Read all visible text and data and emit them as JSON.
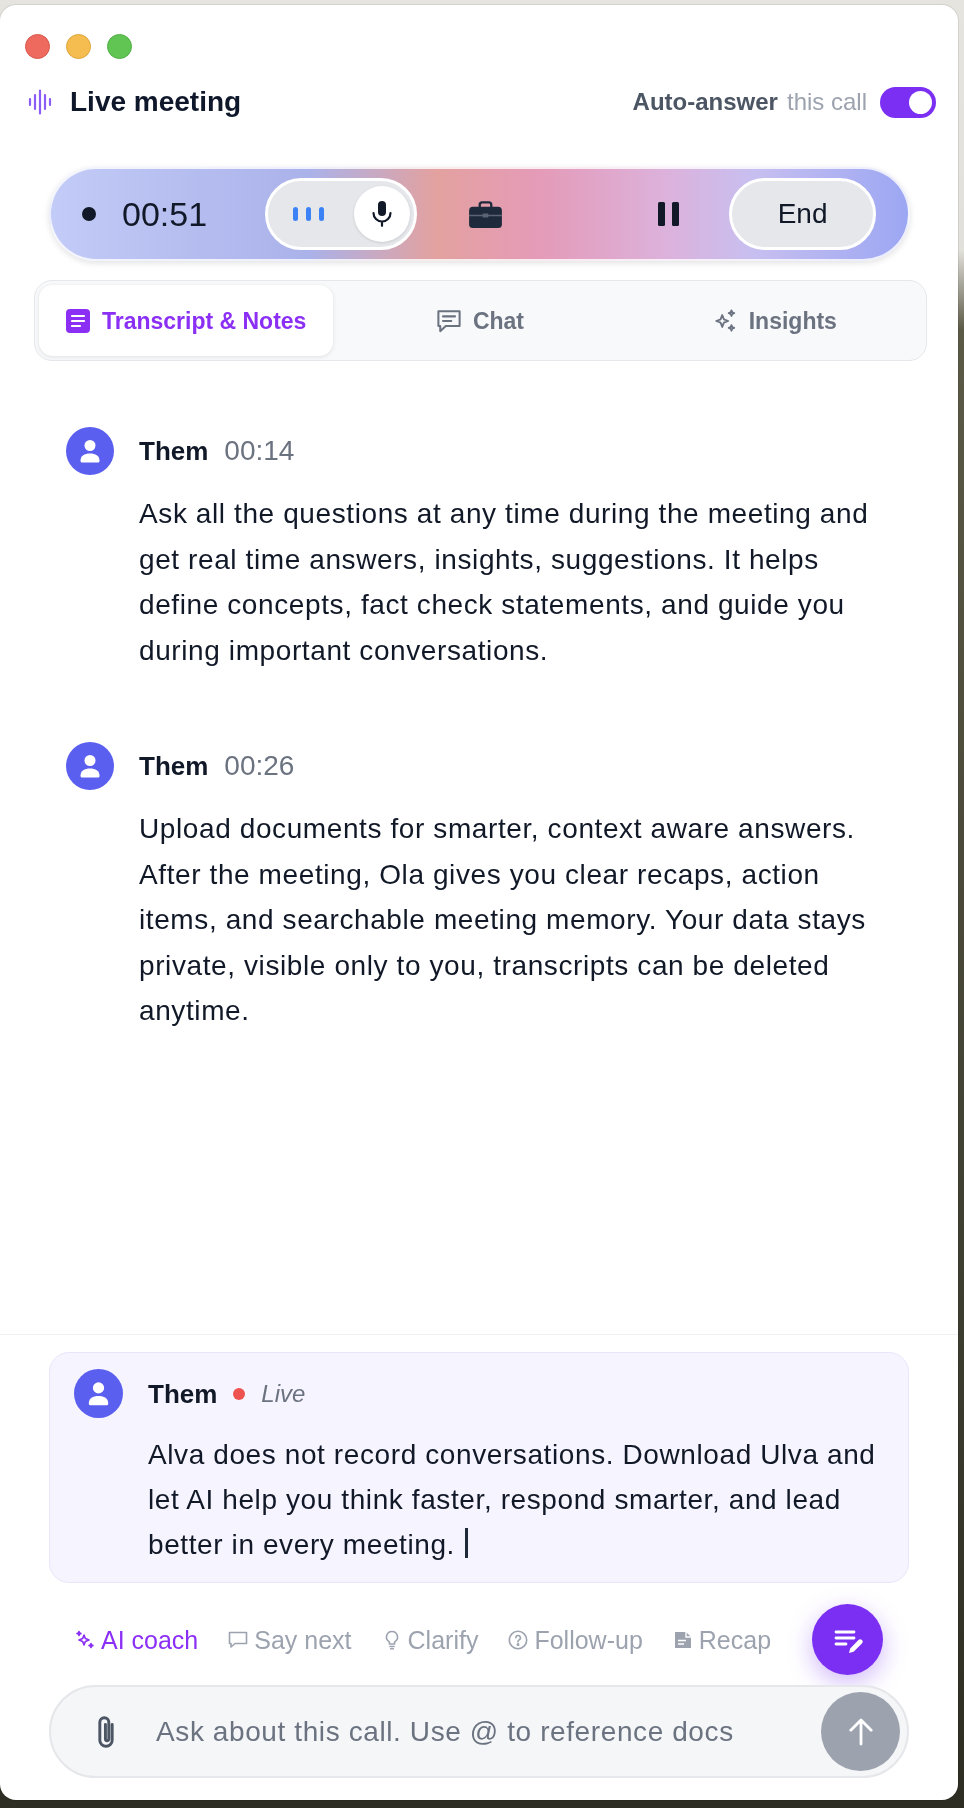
{
  "window": {
    "title": "Live meeting"
  },
  "auto_answer": {
    "label": "Auto-answer",
    "note": "this call",
    "on": true
  },
  "call_bar": {
    "timer": "00:51",
    "mic_selected": true,
    "end_button": "End"
  },
  "tabs": [
    {
      "label": "Transcript & Notes",
      "selected": true
    },
    {
      "label": "Chat",
      "selected": false
    },
    {
      "label": "Insights",
      "selected": false
    }
  ],
  "transcript": [
    {
      "speaker": "Them",
      "time": "00:14",
      "text": "Ask all the questions at any time during the meeting and get real time answers, insights, suggestions. It helps define concepts, fact check statements, and guide you during important conversations."
    },
    {
      "speaker": "Them",
      "time": "00:26",
      "text": "Upload documents for smarter, context aware answers. After the meeting, Ola gives you clear recaps, action items, and searchable meeting memory. Your data stays private, visible only to you, transcripts can be deleted anytime."
    }
  ],
  "live_entry": {
    "speaker": "Them",
    "status": "Live",
    "text": "Alva does not record conversations. Download Ulva and let AI help you think faster, respond smarter, and lead better in every meeting."
  },
  "suggestions": [
    {
      "label": "AI coach",
      "selected": true
    },
    {
      "label": "Say next",
      "selected": false
    },
    {
      "label": "Clarify",
      "selected": false
    },
    {
      "label": "Follow-up",
      "selected": false
    },
    {
      "label": "Recap",
      "selected": false
    }
  ],
  "composer": {
    "placeholder": "Ask about this call. Use @ to reference docs"
  }
}
